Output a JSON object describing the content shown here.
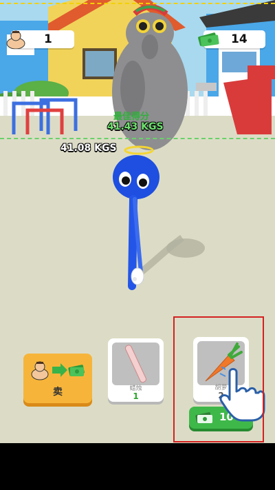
{
  "hud": {
    "strength_count": "1",
    "cash_count": "14"
  },
  "player_weight": "41.08 KGS",
  "best_score": {
    "label": "最佳得分",
    "value": "41.43 KGS"
  },
  "sell_button": {
    "label": "卖"
  },
  "items": [
    {
      "name": "蜡烛",
      "quantity": "1",
      "icon": "stick-icon"
    },
    {
      "name": "胡萝",
      "quantity": "2",
      "icon": "carrot-icon",
      "price": "10"
    }
  ],
  "colors": {
    "accent_green": "#3fb84a",
    "sell_orange": "#f6b53a",
    "highlight_red": "#d32020",
    "character_blue": "#1e4fe0"
  }
}
